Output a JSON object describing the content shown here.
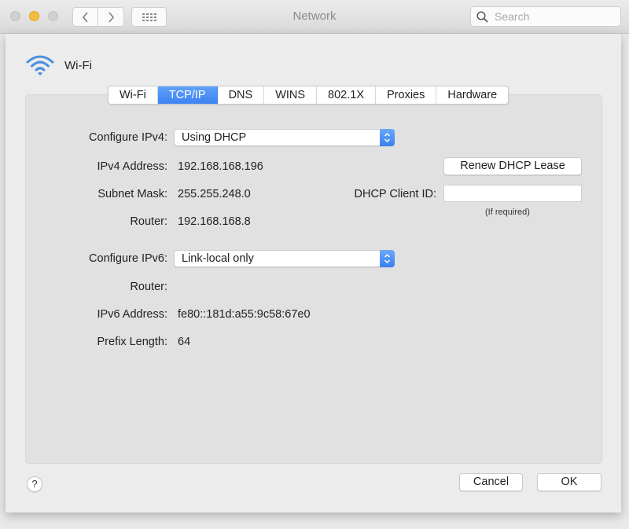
{
  "window": {
    "title": "Network",
    "search_placeholder": "Search",
    "search_value": ""
  },
  "service": {
    "name": "Wi-Fi",
    "icon": "wifi-icon",
    "icon_color": "#4a8fe0"
  },
  "tabs": [
    {
      "label": "Wi-Fi",
      "active": false
    },
    {
      "label": "TCP/IP",
      "active": true
    },
    {
      "label": "DNS",
      "active": false
    },
    {
      "label": "WINS",
      "active": false
    },
    {
      "label": "802.1X",
      "active": false
    },
    {
      "label": "Proxies",
      "active": false
    },
    {
      "label": "Hardware",
      "active": false
    }
  ],
  "ipv4": {
    "configure_label": "Configure IPv4:",
    "configure_value": "Using DHCP",
    "address_label": "IPv4 Address:",
    "address_value": "192.168.168.196",
    "subnet_label": "Subnet Mask:",
    "subnet_value": "255.255.248.0",
    "router_label": "Router:",
    "router_value": "192.168.168.8",
    "renew_button": "Renew DHCP Lease",
    "client_id_label": "DHCP Client ID:",
    "client_id_value": "",
    "client_id_hint": "(If required)"
  },
  "ipv6": {
    "configure_label": "Configure IPv6:",
    "configure_value": "Link-local only",
    "router_label": "Router:",
    "router_value": "",
    "address_label": "IPv6 Address:",
    "address_value": "fe80::181d:a55:9c58:67e0",
    "prefix_label": "Prefix Length:",
    "prefix_value": "64"
  },
  "footer": {
    "help_label": "?",
    "cancel_label": "Cancel",
    "ok_label": "OK"
  },
  "colors": {
    "accent": "#3c82f2",
    "minimize_light": "#f5bd3d"
  }
}
